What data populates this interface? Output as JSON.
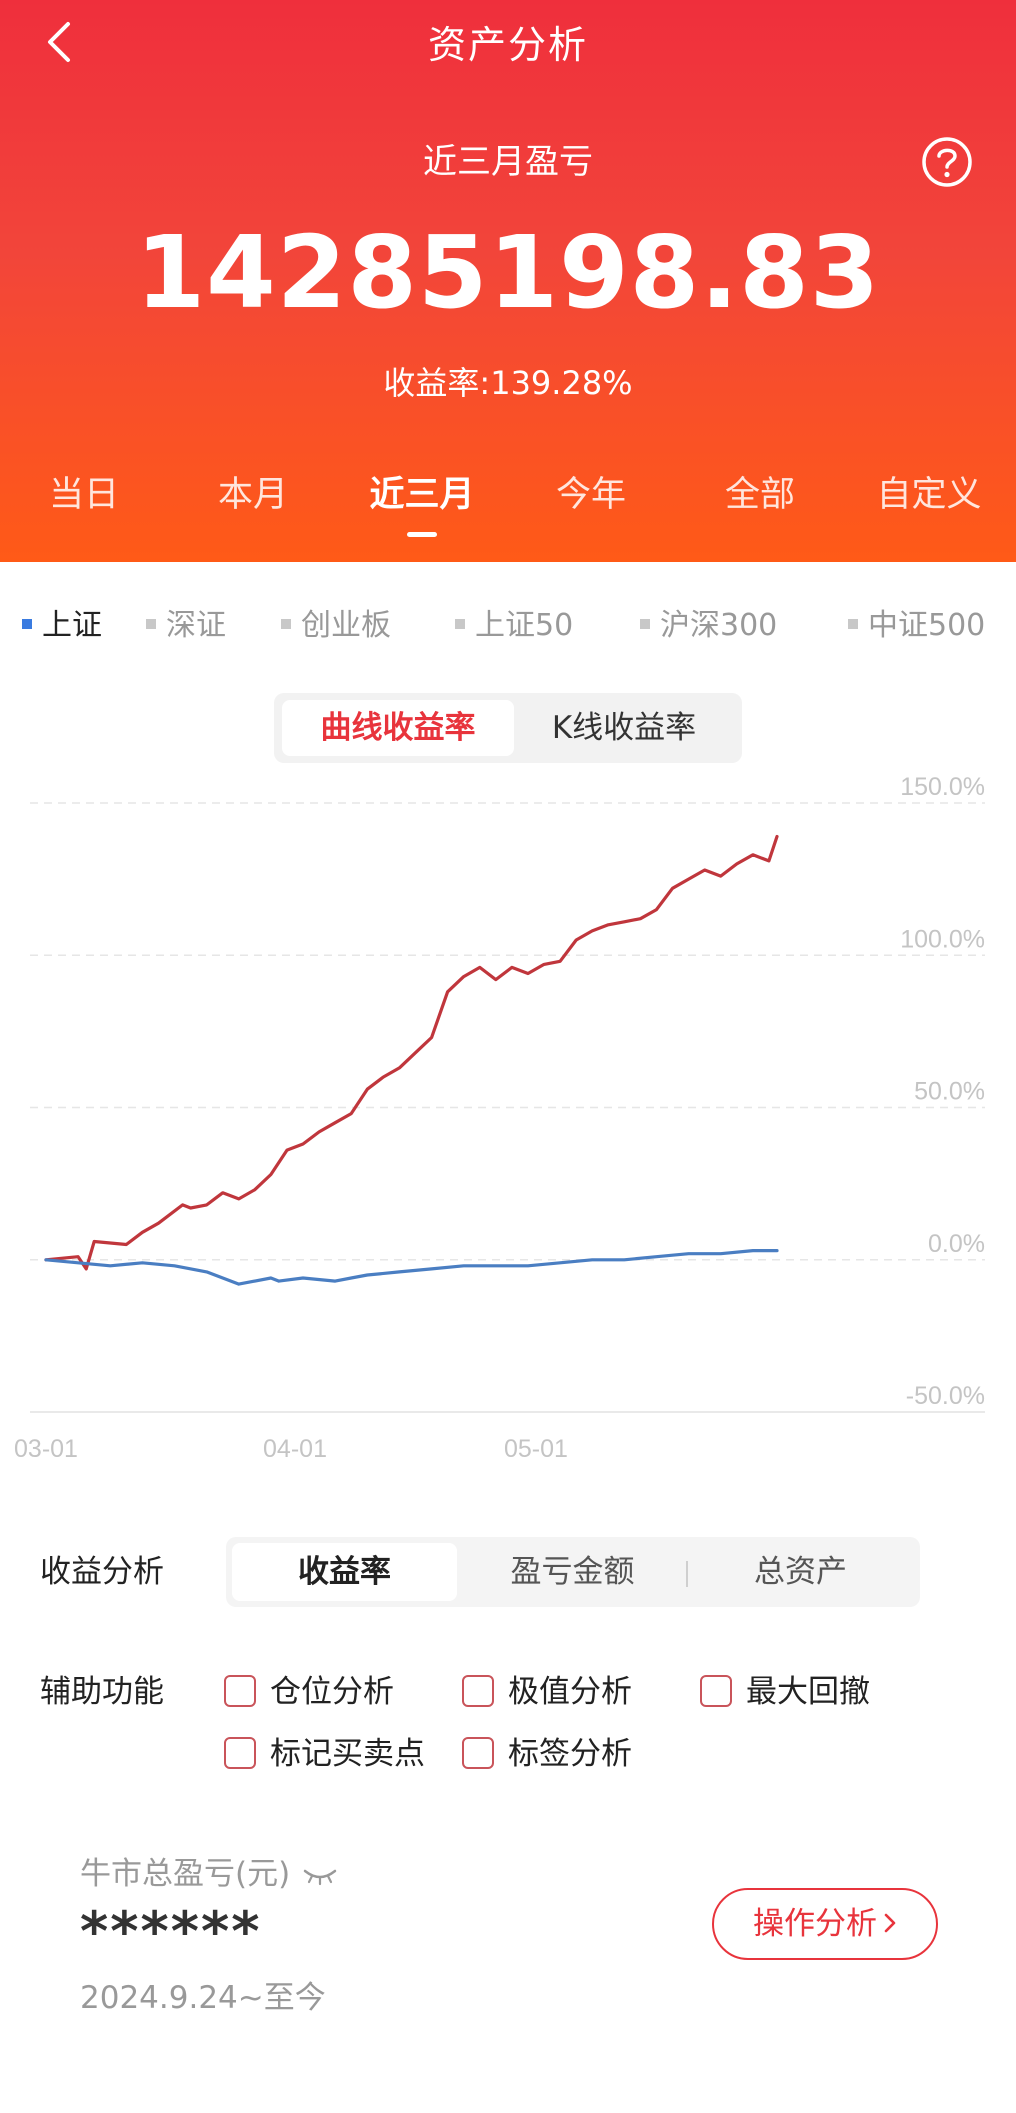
{
  "nav": {
    "title": "资产分析",
    "back_icon": "chevron-left-icon",
    "help_icon": "question-circle-icon"
  },
  "summary": {
    "period_label": "近三月盈亏",
    "total_pnl": "14285198.83",
    "rate_label": "收益率:",
    "rate_value": "139.28%"
  },
  "period_tabs": [
    {
      "label": "当日",
      "active": false
    },
    {
      "label": "本月",
      "active": false
    },
    {
      "label": "近三月",
      "active": true
    },
    {
      "label": "今年",
      "active": false
    },
    {
      "label": "全部",
      "active": false
    },
    {
      "label": "自定义",
      "active": false
    }
  ],
  "index_tabs": [
    {
      "label": "上证",
      "active": true
    },
    {
      "label": "深证",
      "active": false
    },
    {
      "label": "创业板",
      "active": false
    },
    {
      "label": "上证50",
      "active": false
    },
    {
      "label": "沪深300",
      "active": false
    },
    {
      "label": "中证500",
      "active": false
    }
  ],
  "chart_mode": [
    {
      "label": "曲线收益率",
      "active": true
    },
    {
      "label": "K线收益率",
      "active": false
    }
  ],
  "chart_data": {
    "type": "line",
    "ylim": [
      -50,
      150
    ],
    "y_ticks": [
      "150.0%",
      "100.0%",
      "50.0%",
      "0.0%",
      "-50.0%"
    ],
    "y_tick_values": [
      150,
      100,
      50,
      0,
      -50
    ],
    "x_ticks": [
      "03-01",
      "04-01",
      "05-01"
    ],
    "x_tick_index": [
      0,
      31,
      61
    ],
    "x_max_index": 92,
    "grid": true,
    "series": [
      {
        "color": "#c0363c",
        "x": [
          0,
          4,
          5,
          6,
          10,
          12,
          14,
          17,
          18,
          20,
          22,
          24,
          26,
          28,
          30,
          32,
          34,
          36,
          38,
          40,
          42,
          44,
          46,
          48,
          50,
          52,
          54,
          56,
          58,
          60,
          62,
          64,
          66,
          68,
          70,
          72,
          74,
          76,
          78,
          80,
          82,
          84,
          86,
          88,
          90,
          91
        ],
        "values": [
          0,
          1,
          -3,
          6,
          5,
          9,
          12,
          18,
          17,
          18,
          22,
          20,
          23,
          28,
          36,
          38,
          42,
          45,
          48,
          56,
          60,
          63,
          68,
          73,
          88,
          93,
          96,
          92,
          96,
          94,
          97,
          98,
          105,
          108,
          110,
          111,
          112,
          115,
          122,
          125,
          128,
          126,
          130,
          133,
          131,
          139
        ]
      },
      {
        "color": "#4a7ec2",
        "x": [
          0,
          4,
          8,
          12,
          16,
          20,
          24,
          28,
          29,
          32,
          36,
          38,
          40,
          44,
          48,
          52,
          56,
          60,
          64,
          68,
          72,
          76,
          80,
          84,
          88,
          91
        ],
        "values": [
          0,
          -1,
          -2,
          -1,
          -2,
          -4,
          -8,
          -6,
          -7,
          -6,
          -7,
          -6,
          -5,
          -4,
          -3,
          -2,
          -2,
          -2,
          -1,
          0,
          0,
          1,
          2,
          2,
          3,
          3
        ]
      }
    ]
  },
  "analysis": {
    "label": "收益分析",
    "options": [
      {
        "label": "收益率",
        "active": true
      },
      {
        "label": "盈亏金额",
        "active": false
      },
      {
        "label": "总资产",
        "active": false
      }
    ]
  },
  "aux": {
    "label": "辅助功能",
    "options": [
      "仓位分析",
      "极值分析",
      "最大回撤",
      "标记买卖点",
      "标签分析"
    ]
  },
  "bull": {
    "title": "牛市总盈亏(元)",
    "value": "******",
    "range": "2024.9.24~至今",
    "button_label": "操作分析",
    "button_icon": "chevron-right-icon",
    "eye_icon": "eye-closed-icon"
  }
}
